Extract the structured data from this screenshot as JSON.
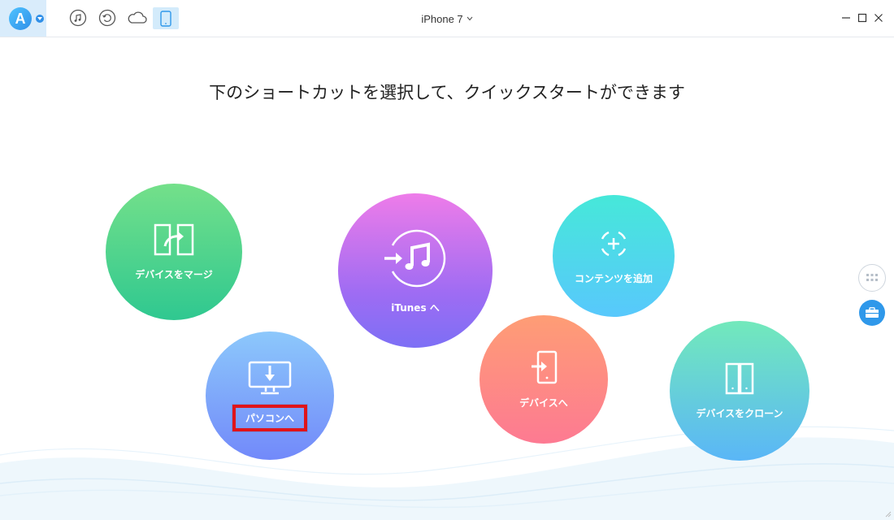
{
  "titlebar": {
    "device_name": "iPhone 7"
  },
  "main": {
    "headline": "下のショートカットを選択して、クイックスタートができます"
  },
  "shortcuts": {
    "merge": "デバイスをマージ",
    "itunes": "iTunes へ",
    "add_content": "コンテンツを追加",
    "to_pc": "パソコンへ",
    "to_device": "デバイスへ",
    "clone": "デバイスをクローン"
  },
  "colors": {
    "accent": "#2f98ea",
    "highlight_border": "#e0141a",
    "merge": [
      "#74e08a",
      "#2fc890"
    ],
    "itunes": [
      "#ee7ce9",
      "#7d6ff5"
    ],
    "add_content": [
      "#46e8d9",
      "#58c8fc"
    ],
    "to_pc": [
      "#8cc8fb",
      "#7289fa"
    ],
    "to_device": [
      "#fe9d75",
      "#fd7a92"
    ],
    "clone": [
      "#72e9bb",
      "#5ab6f7"
    ]
  },
  "icons": {
    "toolbar": [
      "music-icon",
      "restore-icon",
      "cloud-icon",
      "device-icon"
    ],
    "window": [
      "minimize-icon",
      "maximize-icon",
      "close-icon"
    ],
    "side": [
      "grid-icon",
      "toolbox-icon"
    ]
  }
}
